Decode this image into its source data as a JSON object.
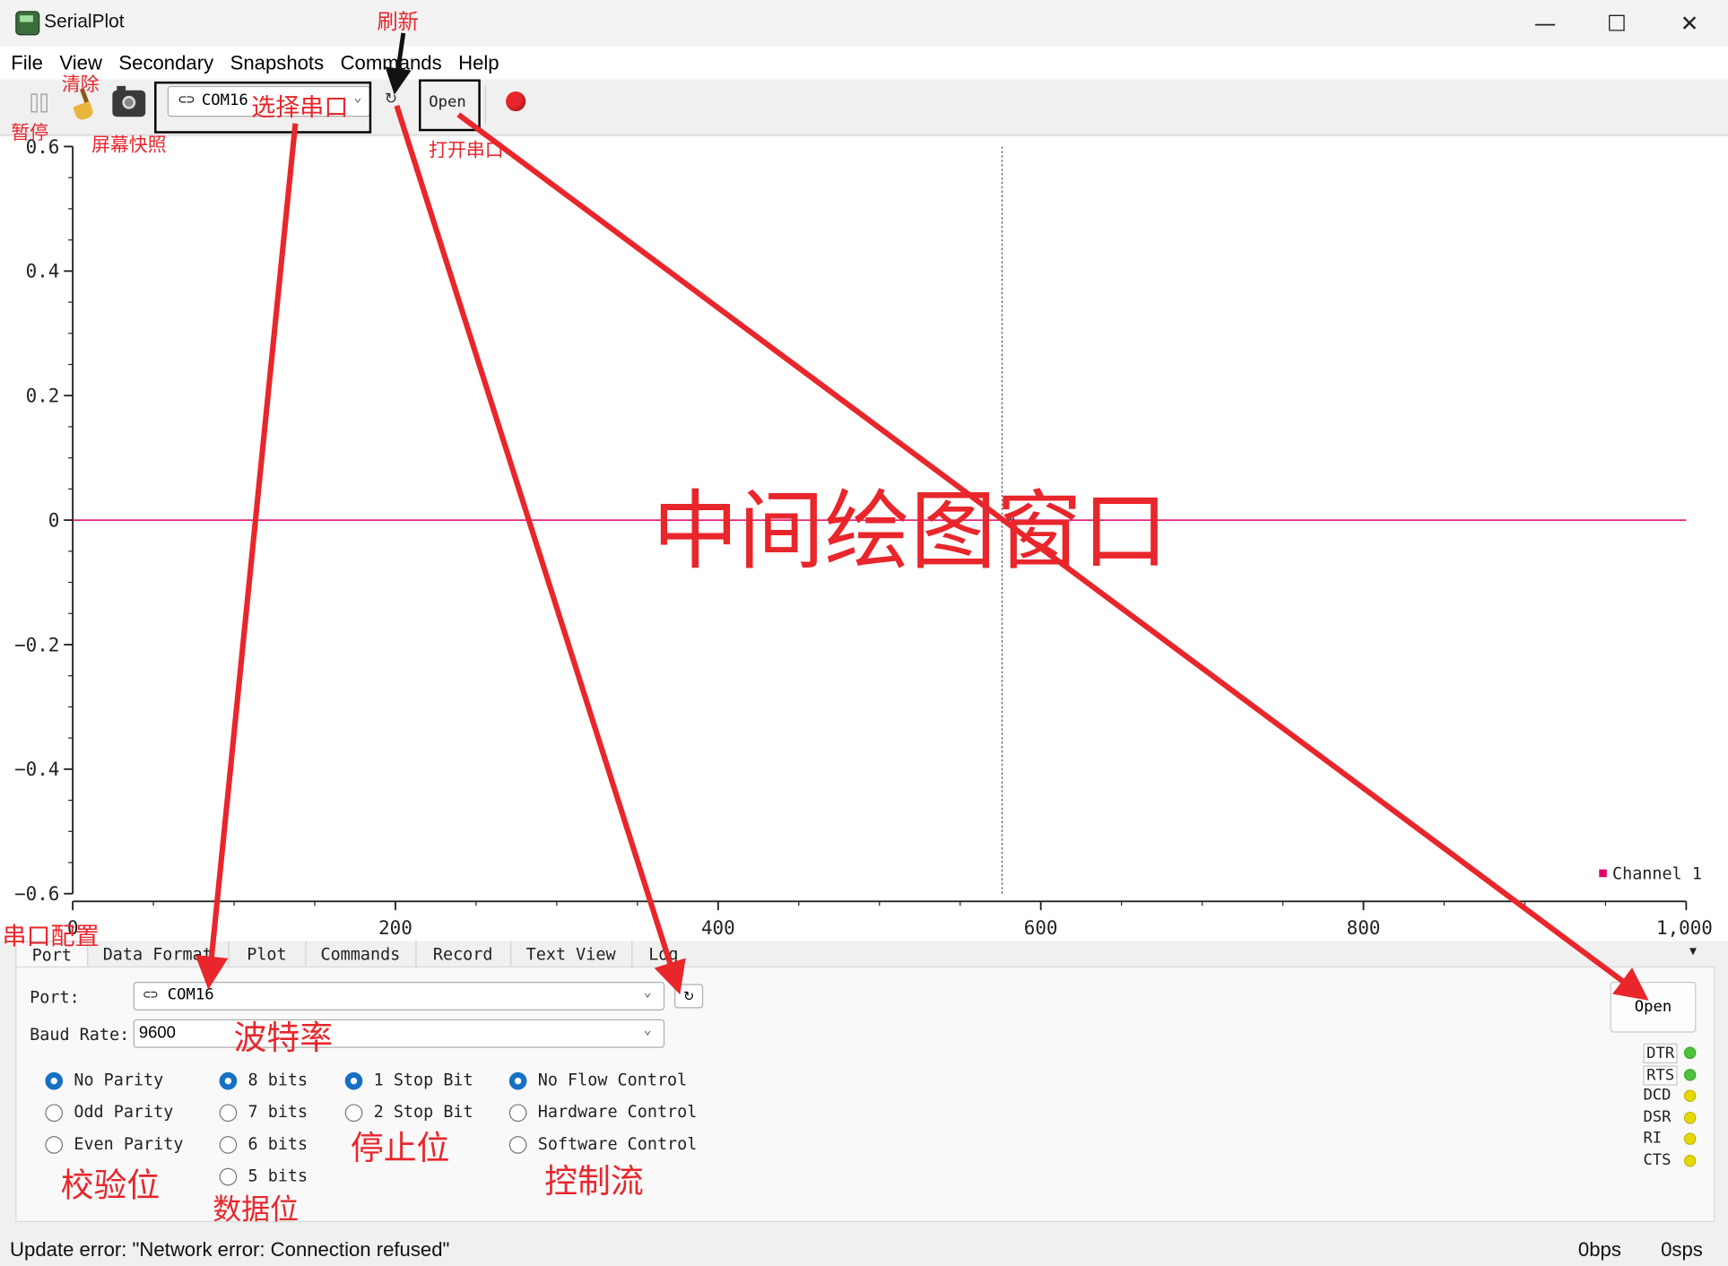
{
  "window": {
    "title": "SerialPlot",
    "minimize": "—",
    "maximize": "☐",
    "close": "✕"
  },
  "menu": [
    "File",
    "View",
    "Secondary",
    "Snapshots",
    "Commands",
    "Help"
  ],
  "toolbar": {
    "port_value": "COM16",
    "refresh_glyph": "↻",
    "open_label": "Open",
    "record_color": "#e8262b"
  },
  "plot": {
    "center_label": "0",
    "legend": "Channel 1"
  },
  "chart_data": {
    "type": "line",
    "series": [
      {
        "name": "Channel 1",
        "x": [
          0,
          1000
        ],
        "y": [
          0,
          0
        ],
        "color": "#e0006a"
      }
    ],
    "xlim": [
      0,
      1000
    ],
    "ylim": [
      -0.6,
      0.6
    ],
    "x_ticks": [
      "0",
      "200",
      "400",
      "600",
      "800",
      "1,000"
    ],
    "y_ticks": [
      "0.6",
      "0.4",
      "0.2",
      "0",
      "−0.2",
      "−0.4",
      "−0.6"
    ],
    "x_tick_values": [
      0,
      200,
      400,
      600,
      800,
      1000
    ],
    "y_tick_values": [
      0.6,
      0.4,
      0.2,
      0,
      -0.2,
      -0.4,
      -0.6
    ],
    "vertical_marker_x": 576,
    "grid": false,
    "legend_placement": "bottom-right"
  },
  "tabs": [
    "Port",
    "Data Format",
    "Plot",
    "Commands",
    "Record",
    "Text View",
    "Log"
  ],
  "tabs_more": "▾",
  "port_panel": {
    "port_label": "Port:",
    "port_value": "COM16",
    "baud_label": "Baud Rate:",
    "baud_value": "9600",
    "refresh_glyph": "↻",
    "open_label": "Open",
    "parity": [
      {
        "label": "No Parity",
        "checked": true
      },
      {
        "label": "Odd Parity",
        "checked": false
      },
      {
        "label": "Even Parity",
        "checked": false
      }
    ],
    "data_bits": [
      {
        "label": "8 bits",
        "checked": true
      },
      {
        "label": "7 bits",
        "checked": false
      },
      {
        "label": "6 bits",
        "checked": false
      },
      {
        "label": "5 bits",
        "checked": false
      }
    ],
    "stop_bits": [
      {
        "label": "1 Stop Bit",
        "checked": true
      },
      {
        "label": "2 Stop Bit",
        "checked": false
      }
    ],
    "flow_control": [
      {
        "label": "No Flow Control",
        "checked": true
      },
      {
        "label": "Hardware Control",
        "checked": false
      },
      {
        "label": "Software Control",
        "checked": false
      }
    ],
    "pins": [
      {
        "label": "DTR",
        "color": "#4cc23a",
        "button": true
      },
      {
        "label": "RTS",
        "color": "#4cc23a",
        "button": true
      },
      {
        "label": "DCD",
        "color": "#e6d800",
        "button": false
      },
      {
        "label": "DSR",
        "color": "#e6d800",
        "button": false
      },
      {
        "label": "RI",
        "color": "#e6d800",
        "button": false
      },
      {
        "label": "CTS",
        "color": "#e6d800",
        "button": false
      }
    ]
  },
  "status": {
    "message": "Update error: \"Network error: Connection refused\"",
    "bps": "0bps",
    "sps": "0sps"
  },
  "annotations": {
    "pause": "暂停",
    "clear": "清除",
    "snapshot": "屏幕快照",
    "select_port": "选择串口",
    "refresh": "刷新",
    "open_port": "打开串口",
    "plot_window": "中间绘图窗口",
    "port_config": "串口配置",
    "baud_rate": "波特率",
    "parity": "校验位",
    "data_bits": "数据位",
    "stop_bits": "停止位",
    "flow_control": "控制流",
    "color": "#e8262b"
  }
}
